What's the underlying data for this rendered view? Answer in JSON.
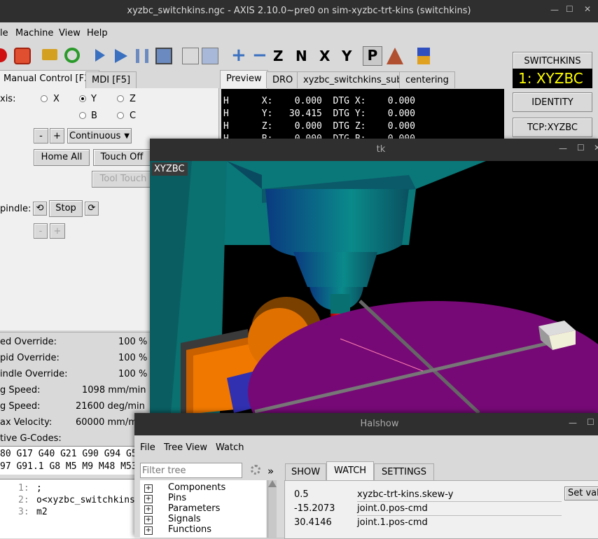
{
  "axis_window": {
    "title": "xyzbc_switchkins.ngc - AXIS 2.10.0~pre0 on sim-xyzbc-trt-kins (switchkins)",
    "menu": [
      "le",
      "Machine",
      "View",
      "Help"
    ],
    "tabs_left": [
      "Manual Control [F3]",
      "MDI [F5]"
    ],
    "tabs_right": [
      "Preview",
      "DRO",
      "xyzbc_switchkins_sub",
      "centering"
    ],
    "axis_label": "xis:",
    "axes": [
      "X",
      "Y",
      "Z",
      "B",
      "C"
    ],
    "selected_axis": "Y",
    "jog_minus": "-",
    "jog_plus": "+",
    "jog_mode": "Continuous",
    "home_all": "Home All",
    "touch_off": "Touch Off",
    "tool_touch": "Tool Touch",
    "spindle_label": "pindle:",
    "stop": "Stop",
    "spindle_minus": "-",
    "spindle_plus": "+",
    "overrides": [
      {
        "label": "ed Override:",
        "value": "100 %"
      },
      {
        "label": "pid Override:",
        "value": "100 %"
      },
      {
        "label": "indle Override:",
        "value": "100 %"
      },
      {
        "label": "g Speed:",
        "value": "1098 mm/min"
      },
      {
        "label": "g Speed:",
        "value": "21600 deg/min"
      },
      {
        "label": "ax Velocity:",
        "value": "60000 mm/m"
      }
    ],
    "gcodes_label": "tive G-Codes:",
    "gcodes_line1": "80 G17 G40 G21 G90 G94 G5",
    "gcodes_line2": "97 G91.1 G8 M5 M9 M48 M53",
    "code_lines": [
      {
        "num": "1:",
        "text": ";"
      },
      {
        "num": "2:",
        "text": "o<xyzbc_switchkins"
      },
      {
        "num": "3:",
        "text": "m2"
      }
    ],
    "dro_lines": [
      "H      X:    0.000  DTG X:    0.000",
      "H      Y:   30.415  DTG Y:    0.000",
      "H      Z:    0.000  DTG Z:    0.000",
      "H      B:    0.000  DTG B:    0.000"
    ],
    "kins_buttons": [
      "SWITCHKINS",
      "IDENTITY",
      "TCP:XYZBC"
    ],
    "kins_display": "1: XYZBC",
    "colors": {
      "dro_text": "#ffffff",
      "kins_display_text": "#ffff00"
    }
  },
  "tk_window": {
    "title": "tk",
    "overlay_label": "XYZBC",
    "colors": {
      "spindle": "#0b8a8a",
      "table": "#7a0a7a",
      "tool": "#e00000",
      "fixture": "#e87a00"
    }
  },
  "halshow_window": {
    "title": "Halshow",
    "menu": [
      "File",
      "Tree View",
      "Watch"
    ],
    "filter_placeholder": "Filter tree",
    "tree": [
      "Components",
      "Pins",
      "Parameters",
      "Signals",
      "Functions"
    ],
    "tabs": [
      "SHOW",
      "WATCH",
      "SETTINGS"
    ],
    "active_tab": "WATCH",
    "watch": [
      {
        "value": "0.5",
        "name": "xyzbc-trt-kins.skew-y"
      },
      {
        "value": "-15.2073",
        "name": "joint.0.pos-cmd"
      },
      {
        "value": "30.4146",
        "name": "joint.1.pos-cmd"
      }
    ],
    "set_button": "Set val",
    "expand_btn": "»"
  }
}
